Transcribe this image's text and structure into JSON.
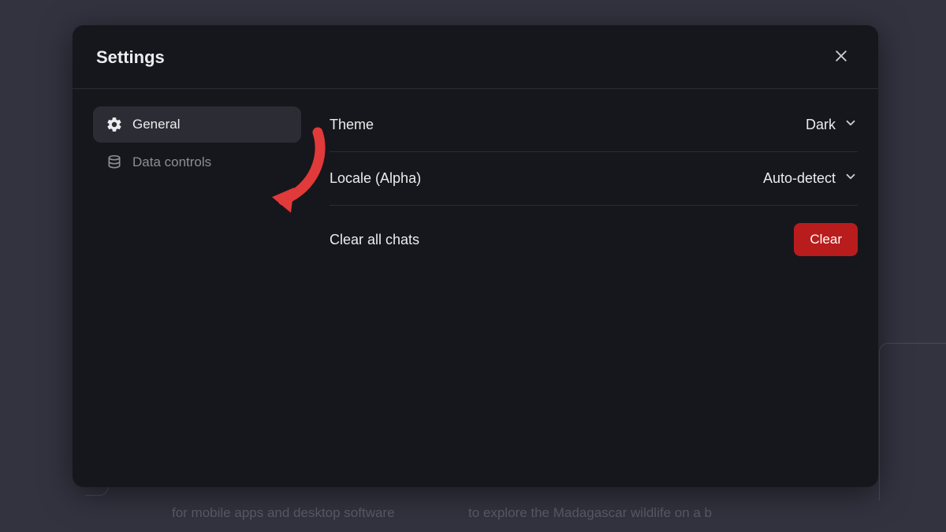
{
  "modal": {
    "title": "Settings"
  },
  "sidebar": {
    "items": [
      {
        "label": "General"
      },
      {
        "label": "Data controls"
      }
    ]
  },
  "settings": {
    "theme": {
      "label": "Theme",
      "value": "Dark"
    },
    "locale": {
      "label": "Locale (Alpha)",
      "value": "Auto-detect"
    },
    "clear": {
      "label": "Clear all chats",
      "button": "Clear"
    }
  },
  "background": {
    "text1": "for mobile apps and desktop software",
    "text2": "to explore the Madagascar wildlife on a b"
  },
  "colors": {
    "modal_bg": "#16171c",
    "page_bg": "#32333f",
    "accent_danger": "#b91c1c",
    "annotation": "#e03a3a",
    "divider": "#2b2c34",
    "text_primary": "#ececef",
    "text_muted": "#8d8d95"
  }
}
